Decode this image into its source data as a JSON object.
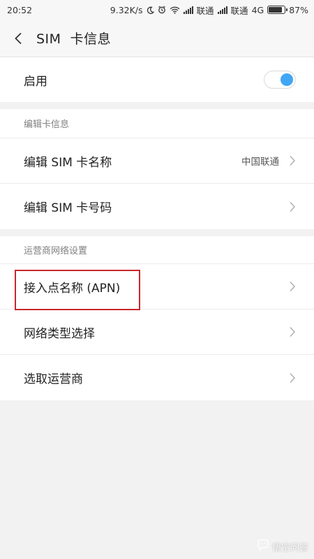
{
  "status_bar": {
    "time": "20:52",
    "net_speed": "9.32K/s",
    "carrier1": "联通",
    "carrier2": "联通",
    "network": "4G",
    "battery": "87%",
    "battery_level": 0.87
  },
  "header": {
    "title": "SIM  卡信息"
  },
  "enable": {
    "label": "启用",
    "toggle_on": true,
    "accent": "#41a6f5"
  },
  "edit_section": {
    "header": "编辑卡信息",
    "name_label": "编辑 SIM 卡名称",
    "name_value": "中国联通",
    "number_label": "编辑 SIM 卡号码"
  },
  "carrier_section": {
    "header": "运营商网络设置",
    "apn_label": "接入点名称 (APN)",
    "network_type_label": "网络类型选择",
    "operator_label": "选取运营商",
    "highlight_color": "#c9272d"
  },
  "watermark": {
    "text": "悟空问答"
  }
}
